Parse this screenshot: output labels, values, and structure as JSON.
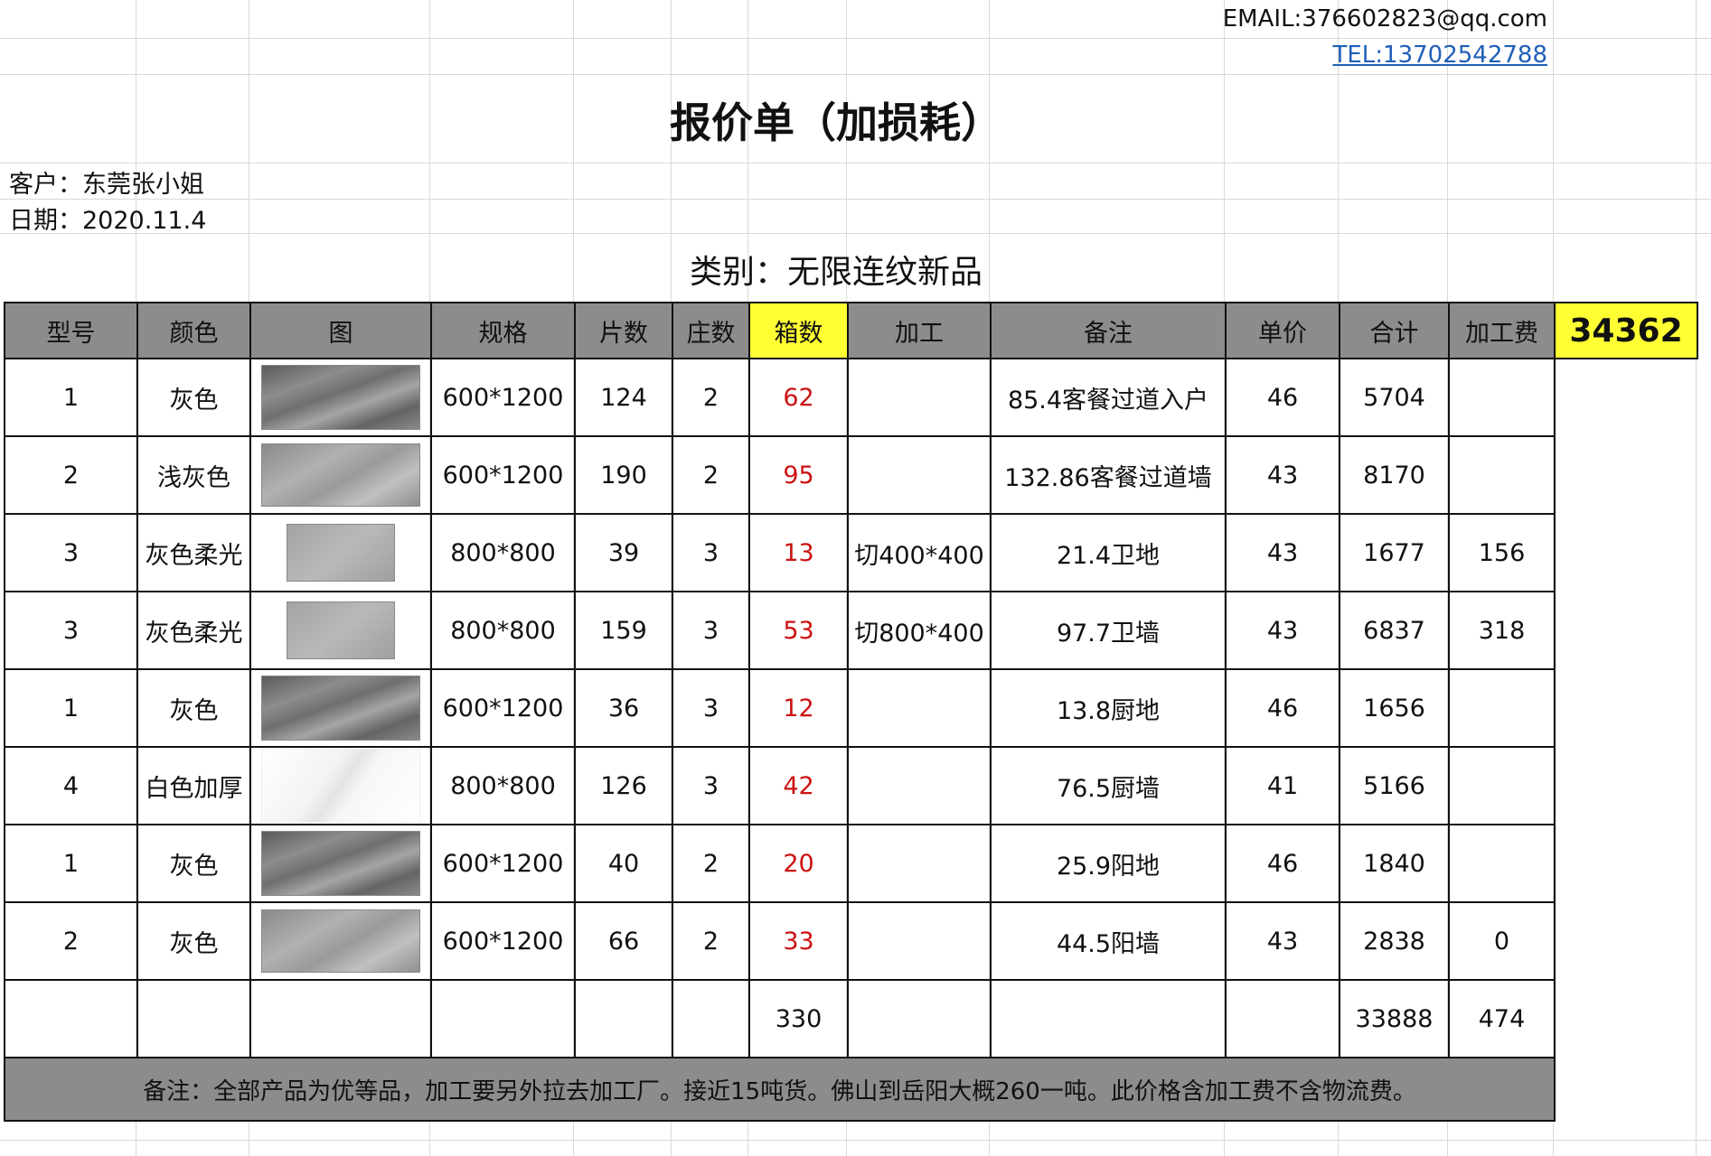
{
  "header": {
    "email": "EMAIL:376602823@qq.com",
    "tel": "TEL:13702542788",
    "title": "报价单（加损耗）",
    "customer": "客户：东莞张小姐",
    "date": "日期：2020.11.4",
    "category": "类别：无限连纹新品"
  },
  "table": {
    "columns": [
      "型号",
      "颜色",
      "图",
      "规格",
      "片数",
      "庄数",
      "箱数",
      "加工",
      "备注",
      "单价",
      "合计",
      "加工费"
    ],
    "rows": [
      {
        "model": "1",
        "color": "灰色",
        "swatch": "dark",
        "spec": "600*1200",
        "pieces": "124",
        "stacks": "2",
        "boxes": "62",
        "process": "",
        "note": "85.4客餐过道入户",
        "price": "46",
        "total": "5704",
        "fee": ""
      },
      {
        "model": "2",
        "color": "浅灰色",
        "swatch": "mid",
        "spec": "600*1200",
        "pieces": "190",
        "stacks": "2",
        "boxes": "95",
        "process": "",
        "note": "132.86客餐过道墙",
        "price": "43",
        "total": "8170",
        "fee": ""
      },
      {
        "model": "3",
        "color": "灰色柔光",
        "swatch": "light",
        "spec": "800*800",
        "pieces": "39",
        "stacks": "3",
        "boxes": "13",
        "process": "切400*400",
        "note": "21.4卫地",
        "price": "43",
        "total": "1677",
        "fee": "156"
      },
      {
        "model": "3",
        "color": "灰色柔光",
        "swatch": "light",
        "spec": "800*800",
        "pieces": "159",
        "stacks": "3",
        "boxes": "53",
        "process": "切800*400",
        "note": "97.7卫墙",
        "price": "43",
        "total": "6837",
        "fee": "318"
      },
      {
        "model": "1",
        "color": "灰色",
        "swatch": "dark",
        "spec": "600*1200",
        "pieces": "36",
        "stacks": "3",
        "boxes": "12",
        "process": "",
        "note": "13.8厨地",
        "price": "46",
        "total": "1656",
        "fee": ""
      },
      {
        "model": "4",
        "color": "白色加厚",
        "swatch": "white",
        "spec": "800*800",
        "pieces": "126",
        "stacks": "3",
        "boxes": "42",
        "process": "",
        "note": "76.5厨墙",
        "price": "41",
        "total": "5166",
        "fee": ""
      },
      {
        "model": "1",
        "color": "灰色",
        "swatch": "dark",
        "spec": "600*1200",
        "pieces": "40",
        "stacks": "2",
        "boxes": "20",
        "process": "",
        "note": "25.9阳地",
        "price": "46",
        "total": "1840",
        "fee": ""
      },
      {
        "model": "2",
        "color": "灰色",
        "swatch": "mid",
        "spec": "600*1200",
        "pieces": "66",
        "stacks": "2",
        "boxes": "33",
        "process": "",
        "note": "44.5阳墙",
        "price": "43",
        "total": "2838",
        "fee": "0"
      }
    ],
    "sum_boxes": "330",
    "sum_total": "33888",
    "sum_fee": "474",
    "grand_total": "34362",
    "footer_note": "备注：全部产品为优等品，加工要另外拉去加工厂。接近15吨货。佛山到岳阳大概260一吨。此价格含加工费不含物流费。"
  }
}
